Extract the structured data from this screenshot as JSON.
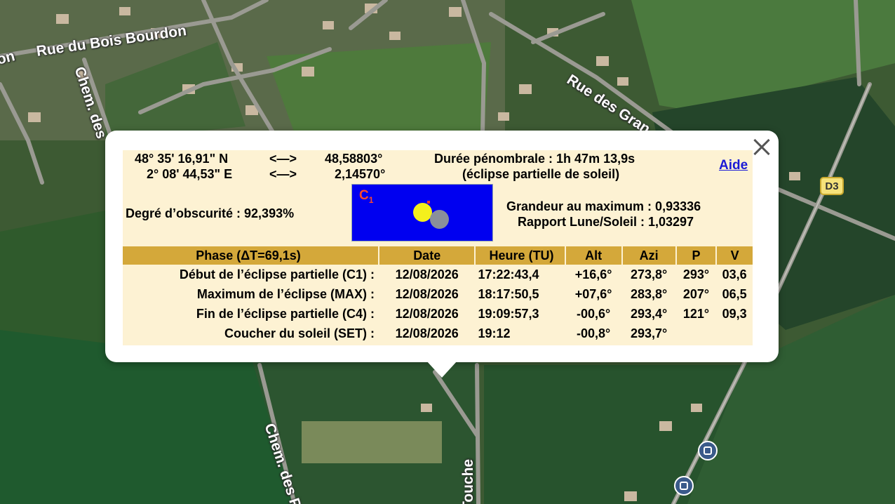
{
  "map": {
    "road_labels": {
      "bois_bourdon": "Rue du Bois Bourdon",
      "on_fragment": "on",
      "chem_des_top": "Chem. des",
      "rue_des_gran": "Rue des Gran",
      "chem_des_p": "Chem. des P",
      "touche": "Touche"
    },
    "road_badge": "D3",
    "icons": [
      "bus-stop-icon",
      "bus-stop-icon",
      "close-icon"
    ]
  },
  "popup": {
    "coords": {
      "lat_dms": "48° 35' 16,91\" N",
      "lat_arrow": "<—>",
      "lat_dec": "48,58803°",
      "lon_dms": "2° 08' 44,53\" E",
      "lon_arrow": "<—>",
      "lon_dec": "2,14570°"
    },
    "duration": "Durée pénombrale : 1h 47m 13,9s",
    "eclipse_type": "(éclipse partielle de soleil)",
    "help_link": "Aide",
    "obscuration": "Degré d’obscurité : 92,393%",
    "contact_label": "C",
    "contact_sub": "1",
    "magnitude": "Grandeur au maximum : 0,93336",
    "ratio": "Rapport Lune/Soleil : 1,03297",
    "table": {
      "headers": [
        "Phase (ΔT=69,1s)",
        "Date",
        "Heure (TU)",
        "Alt",
        "Azi",
        "P",
        "V"
      ],
      "rows": [
        [
          "Début de l’éclipse partielle (C1) :",
          "12/08/2026",
          "17:22:43,4",
          "+16,6°",
          "273,8°",
          "293°",
          "03,6"
        ],
        [
          "Maximum de l’éclipse (MAX) :",
          "12/08/2026",
          "18:17:50,5",
          "+07,6°",
          "283,8°",
          "207°",
          "06,5"
        ],
        [
          "Fin de l’éclipse partielle (C4) :",
          "12/08/2026",
          "19:09:57,3",
          "-00,6°",
          "293,4°",
          "121°",
          "09,3"
        ],
        [
          "Coucher du soleil (SET) :",
          "12/08/2026",
          "19:12",
          "-00,8°",
          "293,7°",
          "",
          ""
        ]
      ]
    }
  }
}
